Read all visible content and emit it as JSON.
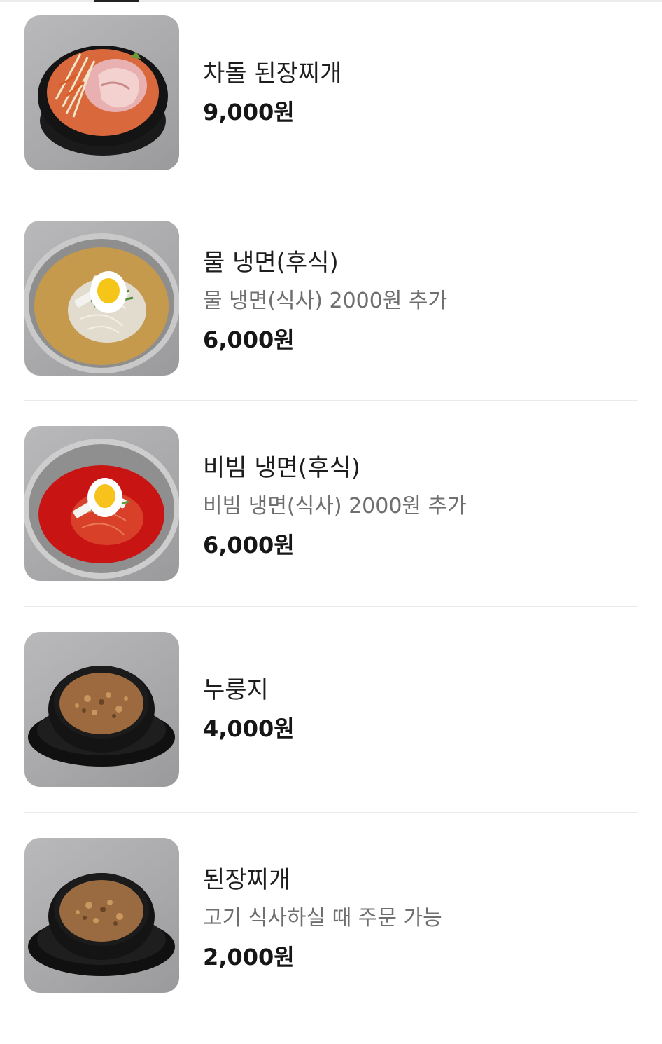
{
  "menu": {
    "items": [
      {
        "name": "차돌 된장찌개",
        "description": "",
        "price": "9,000원",
        "image": "chadol-doenjang-jjigae-photo"
      },
      {
        "name": "물 냉면(후식)",
        "description": "물 냉면(식사) 2000원 추가",
        "price": "6,000원",
        "image": "mul-naengmyeon-photo"
      },
      {
        "name": "비빔 냉면(후식)",
        "description": "비빔 냉면(식사) 2000원 추가",
        "price": "6,000원",
        "image": "bibim-naengmyeon-photo"
      },
      {
        "name": "누룽지",
        "description": "",
        "price": "4,000원",
        "image": "nurungji-photo"
      },
      {
        "name": "된장찌개",
        "description": "고기 식사하실 때 주문 가능",
        "price": "2,000원",
        "image": "doenjang-jjigae-photo"
      }
    ]
  },
  "colors": {
    "text_primary": "#1d1d1d",
    "text_secondary": "#6f6f6f",
    "divider": "#ebebeb",
    "thumb_background": "#a9a9ab"
  }
}
